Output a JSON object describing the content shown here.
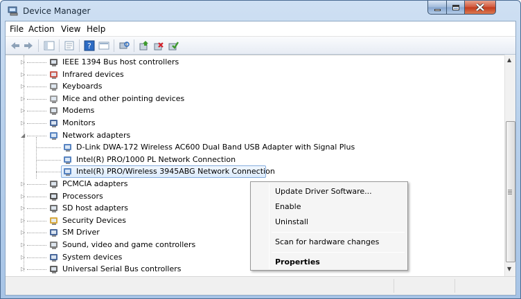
{
  "window": {
    "title": "Device Manager"
  },
  "menu": [
    "File",
    "Action",
    "View",
    "Help"
  ],
  "toolbar": [
    "back-icon",
    "forward-icon",
    "show-hide-tree-icon",
    "properties-icon",
    "help-icon",
    "view-icon",
    "scan-icon",
    "update-driver-icon",
    "uninstall-icon",
    "enable-icon"
  ],
  "tree": {
    "items": [
      {
        "label": "IEEE 1394 Bus host controllers",
        "icon": "ieee-icon"
      },
      {
        "label": "Infrared devices",
        "icon": "infrared-icon"
      },
      {
        "label": "Keyboards",
        "icon": "keyboard-icon"
      },
      {
        "label": "Mice and other pointing devices",
        "icon": "mouse-icon"
      },
      {
        "label": "Modems",
        "icon": "modem-icon"
      },
      {
        "label": "Monitors",
        "icon": "monitor-icon"
      },
      {
        "label": "Network adapters",
        "icon": "network-icon",
        "expanded": true
      },
      {
        "label": "D-Link DWA-172 Wireless AC600 Dual Band USB Adapter with Signal Plus",
        "icon": "network-card-icon",
        "child": true
      },
      {
        "label": "Intel(R) PRO/1000 PL Network Connection",
        "icon": "network-card-icon",
        "child": true
      },
      {
        "label": "Intel(R) PRO/Wireless 3945ABG Network Connection",
        "icon": "network-card-icon",
        "child": true,
        "selected": true
      },
      {
        "label": "PCMCIA adapters",
        "icon": "pcmcia-icon"
      },
      {
        "label": "Processors",
        "icon": "processor-icon"
      },
      {
        "label": "SD host adapters",
        "icon": "sd-icon"
      },
      {
        "label": "Security Devices",
        "icon": "security-icon"
      },
      {
        "label": "SM Driver",
        "icon": "sm-driver-icon"
      },
      {
        "label": "Sound, video and game controllers",
        "icon": "sound-icon"
      },
      {
        "label": "System devices",
        "icon": "system-icon"
      },
      {
        "label": "Universal Serial Bus controllers",
        "icon": "usb-icon"
      }
    ]
  },
  "context_menu": {
    "update": "Update Driver Software...",
    "enable": "Enable",
    "uninstall": "Uninstall",
    "scan": "Scan for hardware changes",
    "properties": "Properties"
  }
}
